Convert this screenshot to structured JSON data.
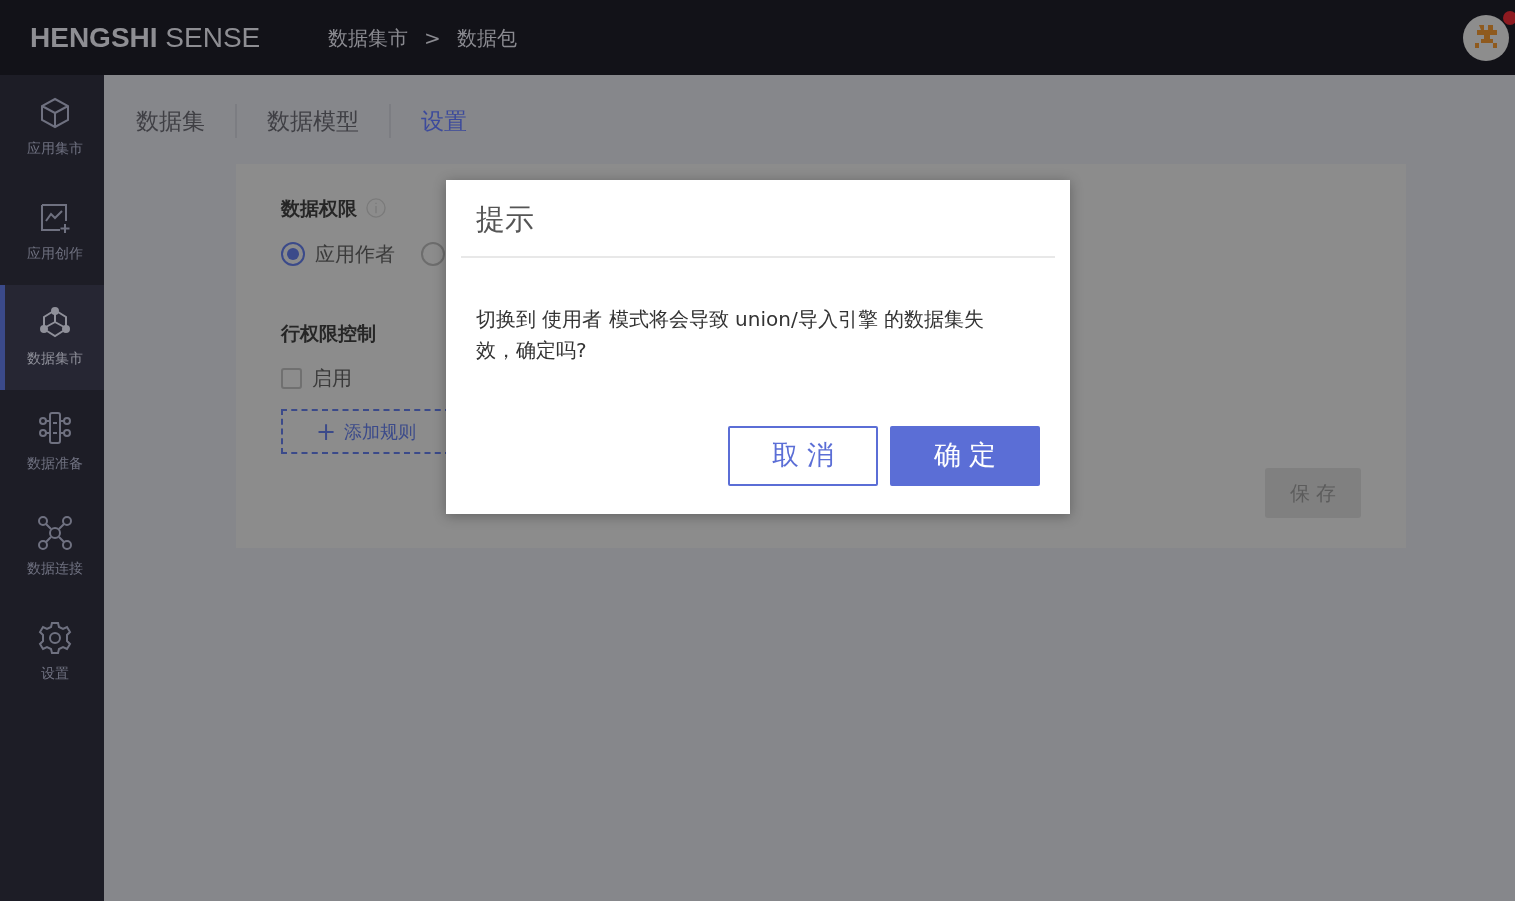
{
  "header": {
    "logo": "HENGSHI SENSE",
    "breadcrumb": [
      "数据集市",
      "数据包"
    ],
    "breadcrumb_separator": ">",
    "notification": true
  },
  "sidebar": {
    "items": [
      {
        "label": "应用集市",
        "kind": "cube",
        "selected": false
      },
      {
        "label": "应用创作",
        "kind": "chart",
        "selected": false
      },
      {
        "label": "数据集市",
        "kind": "hub",
        "selected": true
      },
      {
        "label": "数据准备",
        "kind": "prep",
        "selected": false
      },
      {
        "label": "数据连接",
        "kind": "network",
        "selected": false
      },
      {
        "label": "设置",
        "kind": "gear",
        "selected": false
      }
    ]
  },
  "tabs": [
    {
      "label": "数据集",
      "selected": false
    },
    {
      "label": "数据模型",
      "selected": false
    },
    {
      "label": "设置",
      "selected": true
    }
  ],
  "settings": {
    "permission_title": "数据权限",
    "radio_options": [
      {
        "label": "应用作者",
        "selected": true
      },
      {
        "selected": false
      }
    ],
    "row_control_title": "行权限控制",
    "enable_checkbox": {
      "label": "启用",
      "checked": false
    },
    "add_rule_button": "添加规则",
    "add_rule_icon": "+",
    "save_button": "保 存"
  },
  "dialog": {
    "title": "提示",
    "message": "切换到 使用者 模式将会导致 union/导入引擎 的数据集失效，确定吗?",
    "cancel_button": "取 消",
    "confirm_button": "确 定"
  }
}
